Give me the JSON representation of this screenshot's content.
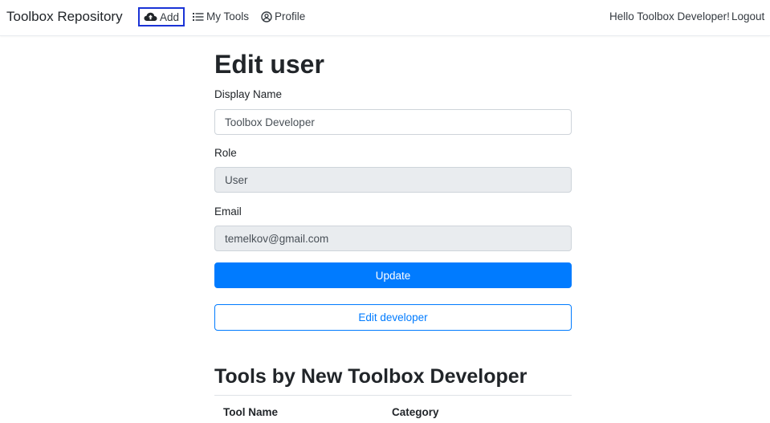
{
  "navbar": {
    "brand": "Toolbox Repository",
    "add_label": "Add",
    "mytools_label": "My Tools",
    "profile_label": "Profile",
    "greeting": "Hello Toolbox Developer!",
    "logout_label": "Logout"
  },
  "page": {
    "title": "Edit user"
  },
  "form": {
    "display_name_label": "Display Name",
    "display_name_value": "Toolbox Developer",
    "role_label": "Role",
    "role_value": "User",
    "email_label": "Email",
    "email_value": "temelkov@gmail.com",
    "update_label": "Update",
    "edit_developer_label": "Edit developer"
  },
  "tools": {
    "title": "Tools by New Toolbox Developer",
    "columns": [
      "Tool Name",
      "Category"
    ]
  },
  "colors": {
    "primary": "#007bff",
    "highlight_box": "#1a33d6"
  },
  "icons": {
    "add": "cloud-upload-icon",
    "mytools": "list-icon",
    "profile": "user-circle-icon"
  }
}
